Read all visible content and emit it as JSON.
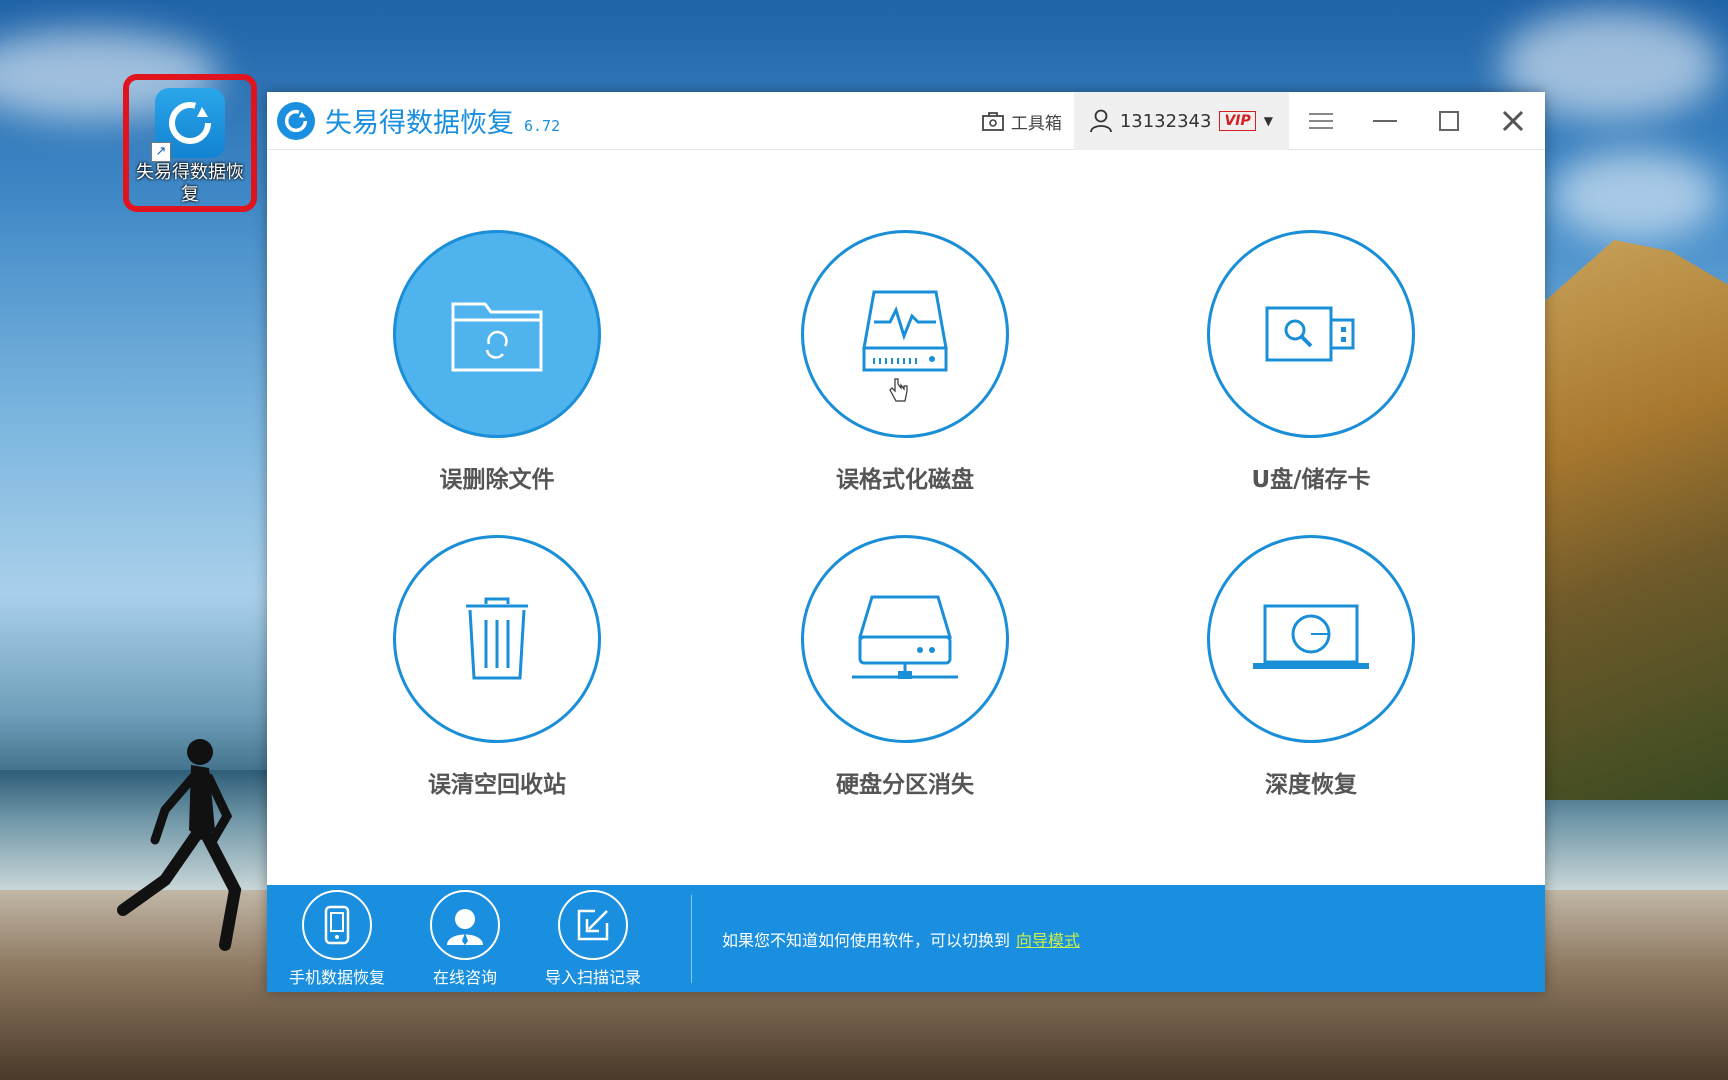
{
  "desktop": {
    "shortcut_label": "失易得数据恢复"
  },
  "window": {
    "title": "失易得数据恢复",
    "version": "6.72",
    "toolbox_label": "工具箱",
    "user_id": "13132343",
    "vip_label": "VIP"
  },
  "tiles": [
    {
      "label": "误删除文件",
      "icon": "folder-recycle-icon",
      "active": true
    },
    {
      "label": "误格式化磁盘",
      "icon": "disk-format-icon",
      "active": false
    },
    {
      "label": "U盘/储存卡",
      "icon": "usb-drive-icon",
      "active": false
    },
    {
      "label": "误清空回收站",
      "icon": "trash-icon",
      "active": false
    },
    {
      "label": "硬盘分区消失",
      "icon": "hard-drive-icon",
      "active": false
    },
    {
      "label": "深度恢复",
      "icon": "laptop-scan-icon",
      "active": false
    }
  ],
  "footer": {
    "buttons": [
      {
        "label": "手机数据恢复",
        "icon": "phone-icon"
      },
      {
        "label": "在线咨询",
        "icon": "support-agent-icon"
      },
      {
        "label": "导入扫描记录",
        "icon": "import-icon"
      }
    ],
    "hint_text": "如果您不知道如何使用软件，可以切换到",
    "hint_link": "向导模式"
  },
  "colors": {
    "accent": "#1a8fe0",
    "active_tile": "#4fb3ee",
    "link": "#c8f24a",
    "highlight_box": "#e0141e"
  }
}
